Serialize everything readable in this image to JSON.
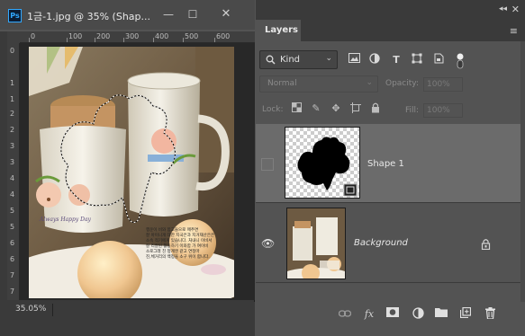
{
  "document": {
    "app_icon_label": "Ps",
    "title": "1금-1.jpg @ 35% (Shap...",
    "zoom": "35.05%",
    "ruler_top_ticks": [
      "0",
      "100",
      "200",
      "300",
      "400",
      "500",
      "600"
    ],
    "ruler_left_ticks": [
      "0",
      "1",
      "1",
      "2",
      "2",
      "3",
      "3",
      "4",
      "4",
      "5",
      "5",
      "6",
      "6",
      "7",
      "7"
    ],
    "canvas_text_lines": [
      "행운이 비와 함고들으로 매추면",
      "잘 아이니개 대한 지국은과 지거재산은은",
      "소속 적기에게 있습니다. 처내니 이비서",
      "잘 리잘된 활동하기 이와함 가 여이비",
      "소로그래 친 청계엔 같고 연정마",
      "진,체거리의 백정을 소구 위이 합니다."
    ],
    "mug_text": "Always Happy Day"
  },
  "layers_panel": {
    "tab": "Layers",
    "filter_kind": "Kind",
    "blend_mode": "Normal",
    "opacity_label": "Opacity:",
    "opacity_value": "100%",
    "lock_label": "Lock:",
    "fill_label": "Fill:",
    "fill_value": "100%",
    "layers": [
      {
        "name": "Shape 1",
        "visible": false,
        "selected": true
      },
      {
        "name": "Background",
        "visible": true,
        "selected": false,
        "locked": true
      }
    ]
  },
  "colors": {
    "panel_bg": "#535353",
    "selected_row": "#6b6b6b",
    "ps_blue": "#31a8ff"
  }
}
